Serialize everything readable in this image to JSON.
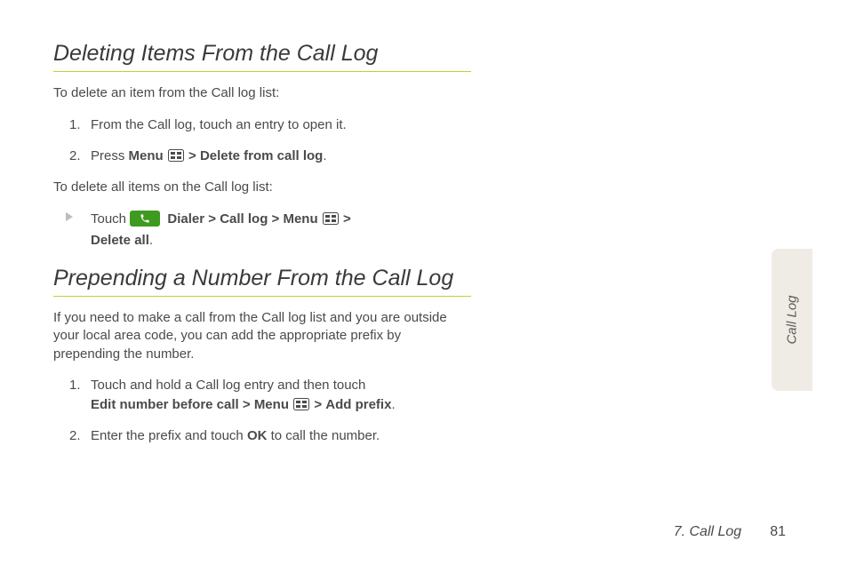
{
  "section1": {
    "heading": "Deleting Items From the Call Log",
    "intro1": "To delete an item from the Call log list:",
    "steps1": [
      {
        "num": "1.",
        "text": "From the Call log, touch an entry to open it."
      },
      {
        "num": "2.",
        "pre": "Press ",
        "b1": "Menu",
        "mid": " ",
        "chev1": ">",
        "b2": "Delete from call log",
        "post": "."
      }
    ],
    "intro2": "To delete all items on the Call log list:",
    "bullet": {
      "pre": "Touch ",
      "b1": "Dialer",
      "chev1": ">",
      "b2": "Call log",
      "chev2": ">",
      "b3": "Menu",
      "chev3": ">",
      "b4": "Delete all",
      "post": "."
    }
  },
  "section2": {
    "heading": "Prepending a Number From the Call Log",
    "intro": "If you need to make a call from the Call log list and you are outside your local area code, you can add the appropriate prefix by prepending the number.",
    "steps": [
      {
        "num": "1.",
        "pre": "Touch and hold a Call log entry and then touch ",
        "b1": "Edit number before call",
        "chev1": ">",
        "b2": "Menu",
        "chev2": ">",
        "b3": "Add prefix",
        "post": "."
      },
      {
        "num": "2.",
        "pre": "Enter the prefix and touch ",
        "b1": "OK",
        "post": " to call the number."
      }
    ]
  },
  "sidetab": "Call Log",
  "footer": {
    "chapter": "7. Call Log",
    "page": "81"
  }
}
